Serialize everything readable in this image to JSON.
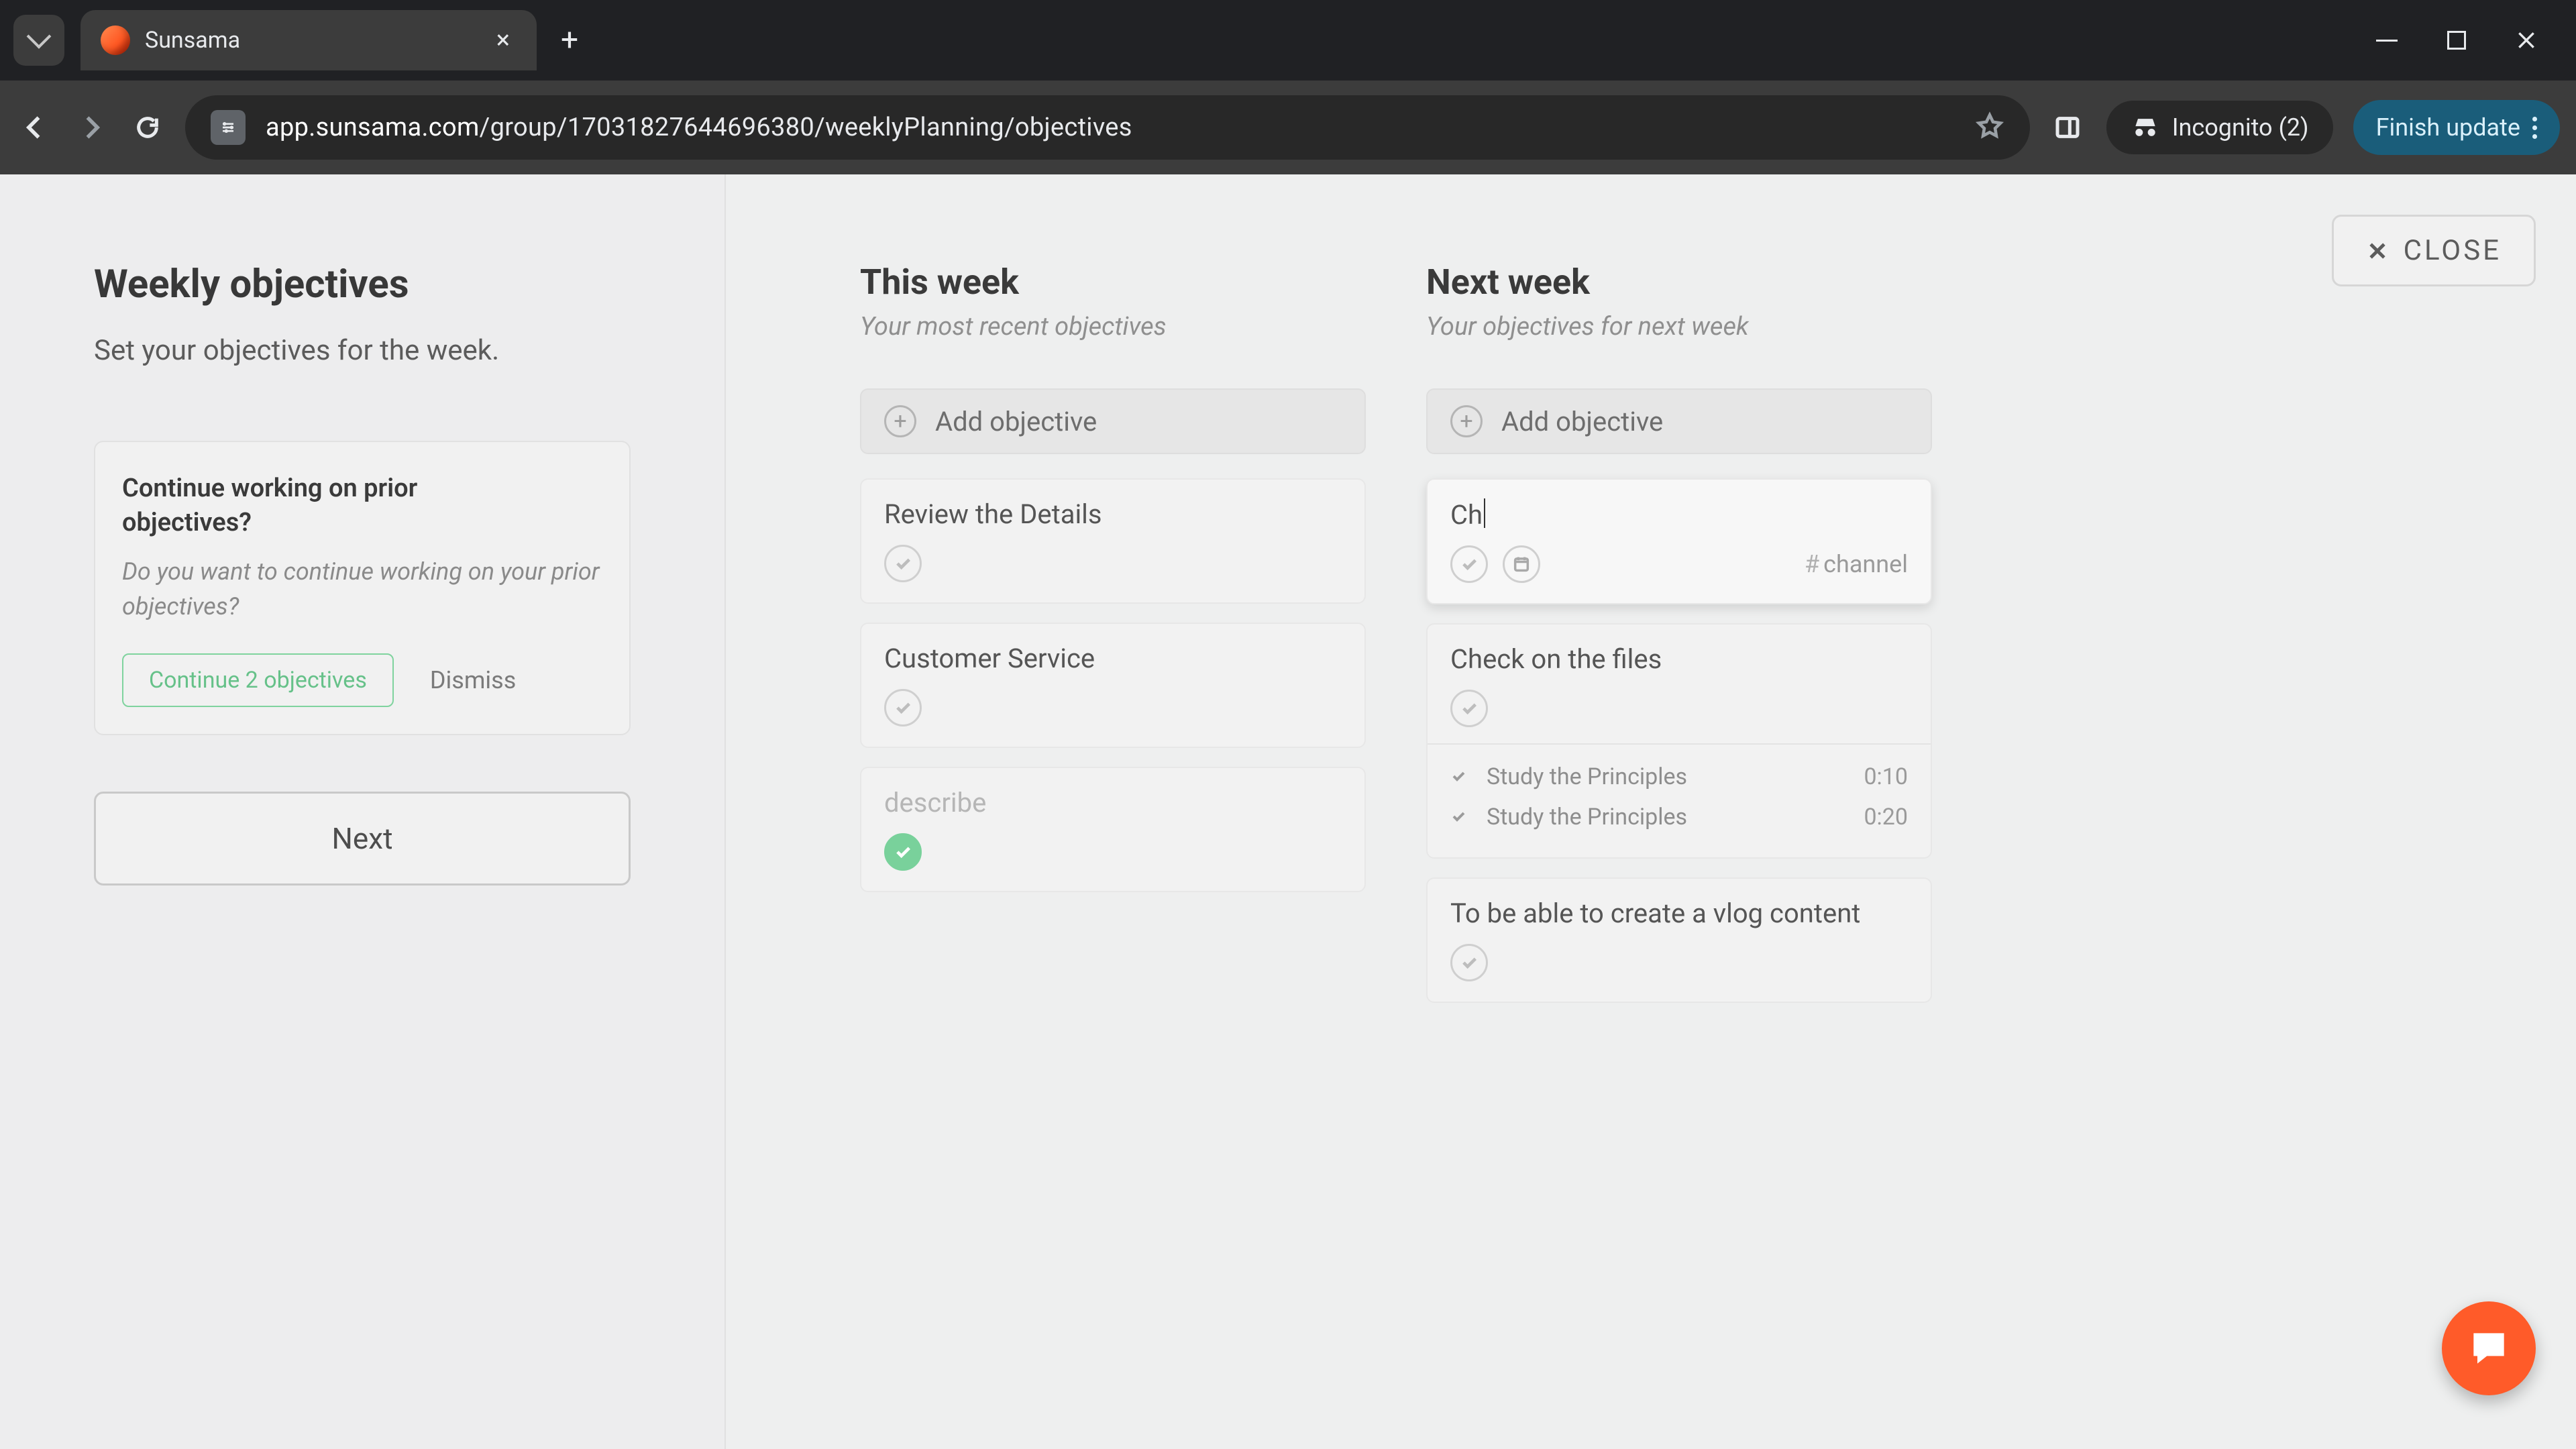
{
  "browser": {
    "tab_title": "Sunsama",
    "url_host": "app.sunsama.com",
    "url_path": "/group/17031827644696380/weeklyPlanning/objectives",
    "incognito_label": "Incognito (2)",
    "update_label": "Finish update"
  },
  "close_label": "CLOSE",
  "sidebar": {
    "title": "Weekly objectives",
    "subtitle": "Set your objectives for the week.",
    "prompt": {
      "question": "Continue working on prior objectives?",
      "description": "Do you want to continue working on your prior objectives?",
      "continue_label": "Continue 2 objectives",
      "dismiss_label": "Dismiss"
    },
    "next_label": "Next"
  },
  "this_week": {
    "title": "This week",
    "subtitle": "Your most recent objectives",
    "add_label": "Add objective",
    "items": [
      {
        "title": "Review the Details",
        "done": false
      },
      {
        "title": "Customer Service",
        "done": false
      },
      {
        "title": "describe",
        "done": true
      }
    ]
  },
  "next_week": {
    "title": "Next week",
    "subtitle": "Your objectives for next week",
    "add_label": "Add objective",
    "editing": {
      "text": "Ch",
      "channel_label": "channel"
    },
    "items": [
      {
        "title": "Check on the files",
        "subtasks": [
          {
            "title": "Study the Principles",
            "duration": "0:10"
          },
          {
            "title": "Study the Principles",
            "duration": "0:20"
          }
        ]
      },
      {
        "title": "To be able to create a vlog content"
      }
    ]
  }
}
